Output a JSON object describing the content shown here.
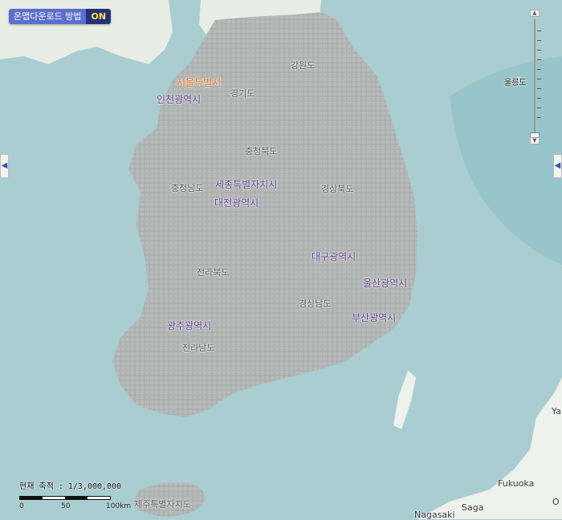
{
  "download_badge": {
    "label": "온맵다운로드 방법",
    "state": "ON"
  },
  "map": {
    "regions": [
      {
        "name": "강원도",
        "kind": "province"
      },
      {
        "name": "서울특별시",
        "kind": "capital"
      },
      {
        "name": "인천광역시",
        "kind": "metro"
      },
      {
        "name": "경기도",
        "kind": "province"
      },
      {
        "name": "충청북도",
        "kind": "province"
      },
      {
        "name": "충청남도",
        "kind": "province"
      },
      {
        "name": "세종특별자치시",
        "kind": "metro"
      },
      {
        "name": "대전광역시",
        "kind": "metro"
      },
      {
        "name": "경상북도",
        "kind": "province"
      },
      {
        "name": "대구광역시",
        "kind": "metro"
      },
      {
        "name": "전라북도",
        "kind": "province"
      },
      {
        "name": "울산광역시",
        "kind": "metro"
      },
      {
        "name": "경상남도",
        "kind": "province"
      },
      {
        "name": "광주광역시",
        "kind": "metro"
      },
      {
        "name": "부산광역시",
        "kind": "metro"
      },
      {
        "name": "전라남도",
        "kind": "province"
      },
      {
        "name": "제주특별자치도",
        "kind": "province"
      }
    ],
    "islands": [
      "울릉도"
    ],
    "foreign_places": [
      "Fukuoka",
      "Saga",
      "Nagasaki",
      "Ya",
      "O"
    ]
  },
  "scale": {
    "text": "현재 축적 : 1/3,000,000",
    "ticks": [
      "0",
      "50",
      "100km"
    ]
  },
  "controls": {
    "zoom_in_icon": "plus-icon",
    "zoom_out_icon": "minus-icon",
    "left_panel_icon": "chevron-left-icon",
    "right_panel_icon": "chevron-left-icon"
  },
  "colors": {
    "sea": "#a9cdd1",
    "land": "#a3a8a6",
    "capital_label": "#e0702a",
    "metro_label": "#5a3d86",
    "province_label": "#555555",
    "badge": "#5b6fcf",
    "badge_on": "#27317a"
  }
}
